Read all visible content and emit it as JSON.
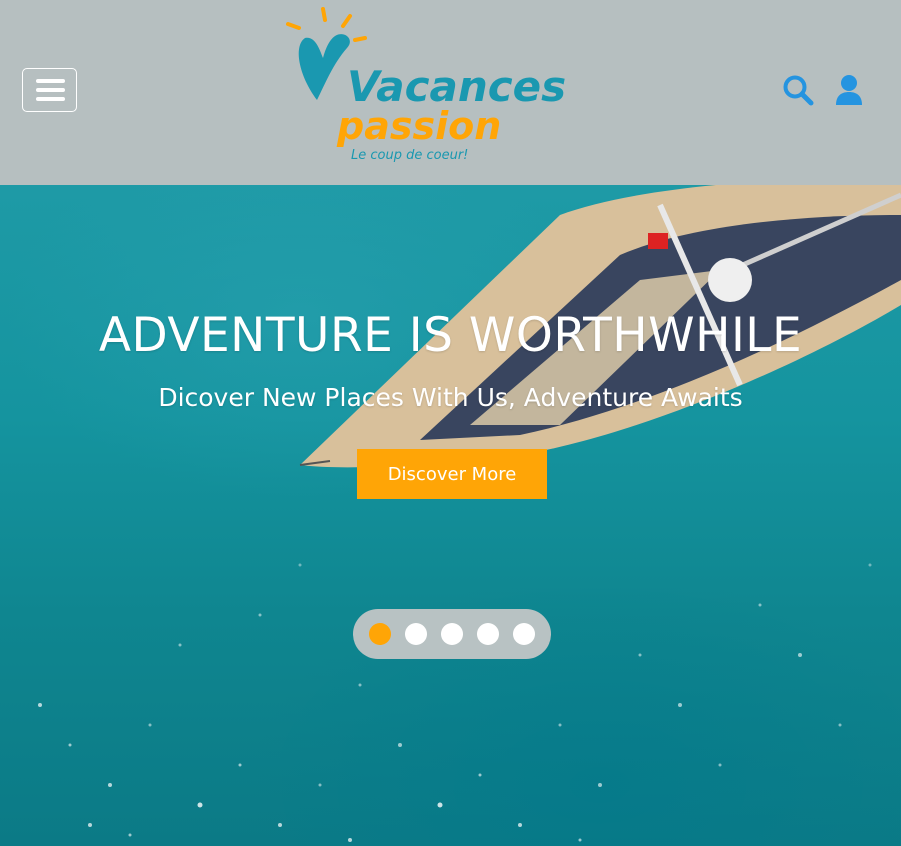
{
  "header": {
    "menu_icon": "hamburger-icon",
    "logo": {
      "brand_line1": "Vacances",
      "brand_line2": "passion",
      "tagline": "Le coup de coeur!"
    },
    "search_icon": "search-icon",
    "account_icon": "user-icon",
    "background_color": "#b6bfc0",
    "icon_color": "#2594e0"
  },
  "hero": {
    "title": "ADVENTURE IS WORTHWHILE",
    "subtitle": "Dicover New Places With Us, Adventure Awaits",
    "cta_label": "Discover More",
    "cta_color": "#ffa506",
    "carousel": {
      "slide_count": 5,
      "active_index": 0,
      "active_color": "#ffa506"
    }
  }
}
